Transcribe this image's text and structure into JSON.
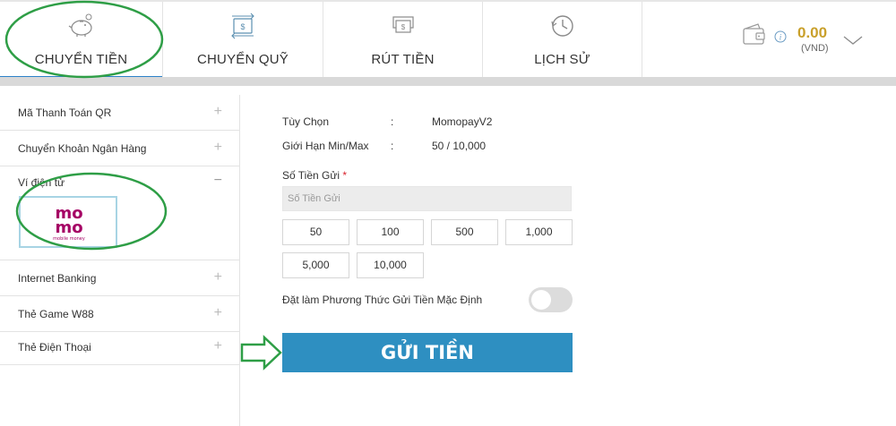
{
  "nav": {
    "tabs": [
      {
        "label": "CHUYỂN TIỀN",
        "icon": "piggy-bank-icon",
        "active": true
      },
      {
        "label": "CHUYỂN QUỸ",
        "icon": "transfer-icon",
        "active": false
      },
      {
        "label": "RÚT TIỀN",
        "icon": "cash-icon",
        "active": false
      },
      {
        "label": "LỊCH SỬ",
        "icon": "history-clock-icon",
        "active": false
      }
    ],
    "balance": "0.00",
    "currency": "(VND)"
  },
  "sidebar": {
    "items": [
      {
        "label": "Mã Thanh Toán QR",
        "sign": "+"
      },
      {
        "label": "Chuyển Khoản Ngân Hàng",
        "sign": "+"
      },
      {
        "label": "Ví điện tử",
        "sign": "−"
      },
      {
        "label": "Internet Banking",
        "sign": "+"
      },
      {
        "label": "Thẻ Game W88",
        "sign": "+"
      },
      {
        "label": "Thẻ Điện Thoại",
        "sign": "+"
      }
    ],
    "momo": {
      "line1": "mo",
      "line2": "mo",
      "tagline": "mobile money"
    }
  },
  "form": {
    "option_label": "Tùy Chọn",
    "option_value": "MomopayV2",
    "limit_label": "Giới Hạn Min/Max",
    "limit_value": "50 / 10,000",
    "separator": ":",
    "amount_label": "Số Tiền Gửi",
    "required_mark": "*",
    "amount_placeholder": "Số Tiền Gửi",
    "quick_amounts": [
      "50",
      "100",
      "500",
      "1,000",
      "5,000",
      "10,000"
    ],
    "default_label": "Đặt làm Phương Thức Gửi Tiền Mặc Định",
    "default_enabled": false,
    "submit_label": "GỬI TIỀN"
  },
  "colors": {
    "accent": "#2e8fc1",
    "tab_underline": "#2c82c9",
    "balance": "#c9a02b",
    "momo": "#a50064",
    "highlight_ring": "#2e9e46",
    "required": "#d9232e"
  }
}
